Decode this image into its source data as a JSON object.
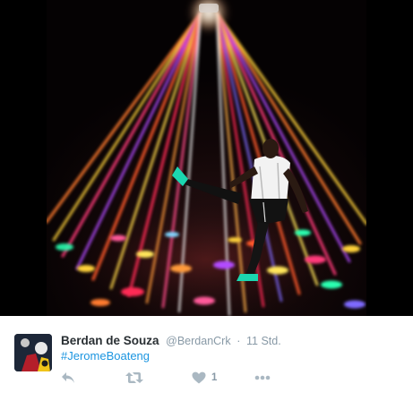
{
  "tweet": {
    "author": {
      "display_name": "Berdan de Souza",
      "handle": "@BerdanCrk",
      "separator": "·",
      "timestamp": "11 Std."
    },
    "text": {
      "hashtag": "#JeromeBoateng"
    },
    "actions": {
      "reply_icon": "reply-icon",
      "retweet_icon": "retweet-icon",
      "like_icon": "heart-icon",
      "like_count": "1",
      "more_icon": "more-dots-icon"
    },
    "media": {
      "description_icon": "disco-light-photo"
    },
    "colors": {
      "name": "#292f33",
      "meta": "#8899a6",
      "link": "#1b95e0",
      "icon": "#aab8c2"
    }
  }
}
